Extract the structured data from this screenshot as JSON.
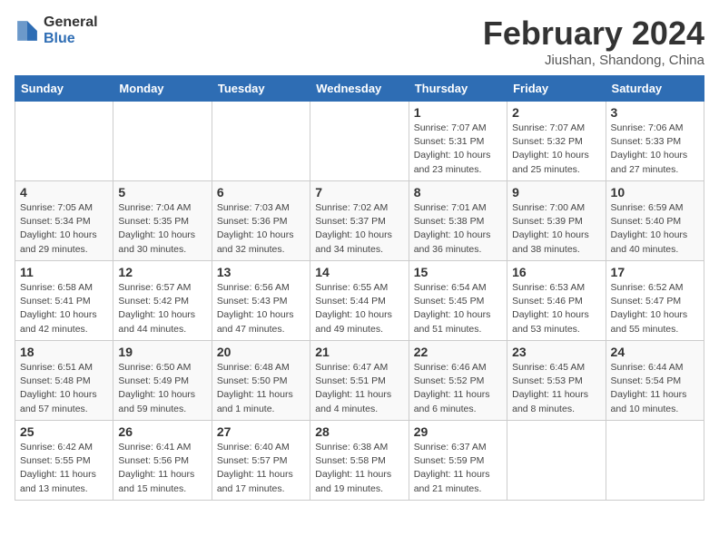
{
  "header": {
    "logo_general": "General",
    "logo_blue": "Blue",
    "month_title": "February 2024",
    "location": "Jiushan, Shandong, China"
  },
  "weekdays": [
    "Sunday",
    "Monday",
    "Tuesday",
    "Wednesday",
    "Thursday",
    "Friday",
    "Saturday"
  ],
  "weeks": [
    [
      {
        "day": "",
        "info": ""
      },
      {
        "day": "",
        "info": ""
      },
      {
        "day": "",
        "info": ""
      },
      {
        "day": "",
        "info": ""
      },
      {
        "day": "1",
        "info": "Sunrise: 7:07 AM\nSunset: 5:31 PM\nDaylight: 10 hours\nand 23 minutes."
      },
      {
        "day": "2",
        "info": "Sunrise: 7:07 AM\nSunset: 5:32 PM\nDaylight: 10 hours\nand 25 minutes."
      },
      {
        "day": "3",
        "info": "Sunrise: 7:06 AM\nSunset: 5:33 PM\nDaylight: 10 hours\nand 27 minutes."
      }
    ],
    [
      {
        "day": "4",
        "info": "Sunrise: 7:05 AM\nSunset: 5:34 PM\nDaylight: 10 hours\nand 29 minutes."
      },
      {
        "day": "5",
        "info": "Sunrise: 7:04 AM\nSunset: 5:35 PM\nDaylight: 10 hours\nand 30 minutes."
      },
      {
        "day": "6",
        "info": "Sunrise: 7:03 AM\nSunset: 5:36 PM\nDaylight: 10 hours\nand 32 minutes."
      },
      {
        "day": "7",
        "info": "Sunrise: 7:02 AM\nSunset: 5:37 PM\nDaylight: 10 hours\nand 34 minutes."
      },
      {
        "day": "8",
        "info": "Sunrise: 7:01 AM\nSunset: 5:38 PM\nDaylight: 10 hours\nand 36 minutes."
      },
      {
        "day": "9",
        "info": "Sunrise: 7:00 AM\nSunset: 5:39 PM\nDaylight: 10 hours\nand 38 minutes."
      },
      {
        "day": "10",
        "info": "Sunrise: 6:59 AM\nSunset: 5:40 PM\nDaylight: 10 hours\nand 40 minutes."
      }
    ],
    [
      {
        "day": "11",
        "info": "Sunrise: 6:58 AM\nSunset: 5:41 PM\nDaylight: 10 hours\nand 42 minutes."
      },
      {
        "day": "12",
        "info": "Sunrise: 6:57 AM\nSunset: 5:42 PM\nDaylight: 10 hours\nand 44 minutes."
      },
      {
        "day": "13",
        "info": "Sunrise: 6:56 AM\nSunset: 5:43 PM\nDaylight: 10 hours\nand 47 minutes."
      },
      {
        "day": "14",
        "info": "Sunrise: 6:55 AM\nSunset: 5:44 PM\nDaylight: 10 hours\nand 49 minutes."
      },
      {
        "day": "15",
        "info": "Sunrise: 6:54 AM\nSunset: 5:45 PM\nDaylight: 10 hours\nand 51 minutes."
      },
      {
        "day": "16",
        "info": "Sunrise: 6:53 AM\nSunset: 5:46 PM\nDaylight: 10 hours\nand 53 minutes."
      },
      {
        "day": "17",
        "info": "Sunrise: 6:52 AM\nSunset: 5:47 PM\nDaylight: 10 hours\nand 55 minutes."
      }
    ],
    [
      {
        "day": "18",
        "info": "Sunrise: 6:51 AM\nSunset: 5:48 PM\nDaylight: 10 hours\nand 57 minutes."
      },
      {
        "day": "19",
        "info": "Sunrise: 6:50 AM\nSunset: 5:49 PM\nDaylight: 10 hours\nand 59 minutes."
      },
      {
        "day": "20",
        "info": "Sunrise: 6:48 AM\nSunset: 5:50 PM\nDaylight: 11 hours\nand 1 minute."
      },
      {
        "day": "21",
        "info": "Sunrise: 6:47 AM\nSunset: 5:51 PM\nDaylight: 11 hours\nand 4 minutes."
      },
      {
        "day": "22",
        "info": "Sunrise: 6:46 AM\nSunset: 5:52 PM\nDaylight: 11 hours\nand 6 minutes."
      },
      {
        "day": "23",
        "info": "Sunrise: 6:45 AM\nSunset: 5:53 PM\nDaylight: 11 hours\nand 8 minutes."
      },
      {
        "day": "24",
        "info": "Sunrise: 6:44 AM\nSunset: 5:54 PM\nDaylight: 11 hours\nand 10 minutes."
      }
    ],
    [
      {
        "day": "25",
        "info": "Sunrise: 6:42 AM\nSunset: 5:55 PM\nDaylight: 11 hours\nand 13 minutes."
      },
      {
        "day": "26",
        "info": "Sunrise: 6:41 AM\nSunset: 5:56 PM\nDaylight: 11 hours\nand 15 minutes."
      },
      {
        "day": "27",
        "info": "Sunrise: 6:40 AM\nSunset: 5:57 PM\nDaylight: 11 hours\nand 17 minutes."
      },
      {
        "day": "28",
        "info": "Sunrise: 6:38 AM\nSunset: 5:58 PM\nDaylight: 11 hours\nand 19 minutes."
      },
      {
        "day": "29",
        "info": "Sunrise: 6:37 AM\nSunset: 5:59 PM\nDaylight: 11 hours\nand 21 minutes."
      },
      {
        "day": "",
        "info": ""
      },
      {
        "day": "",
        "info": ""
      }
    ]
  ]
}
